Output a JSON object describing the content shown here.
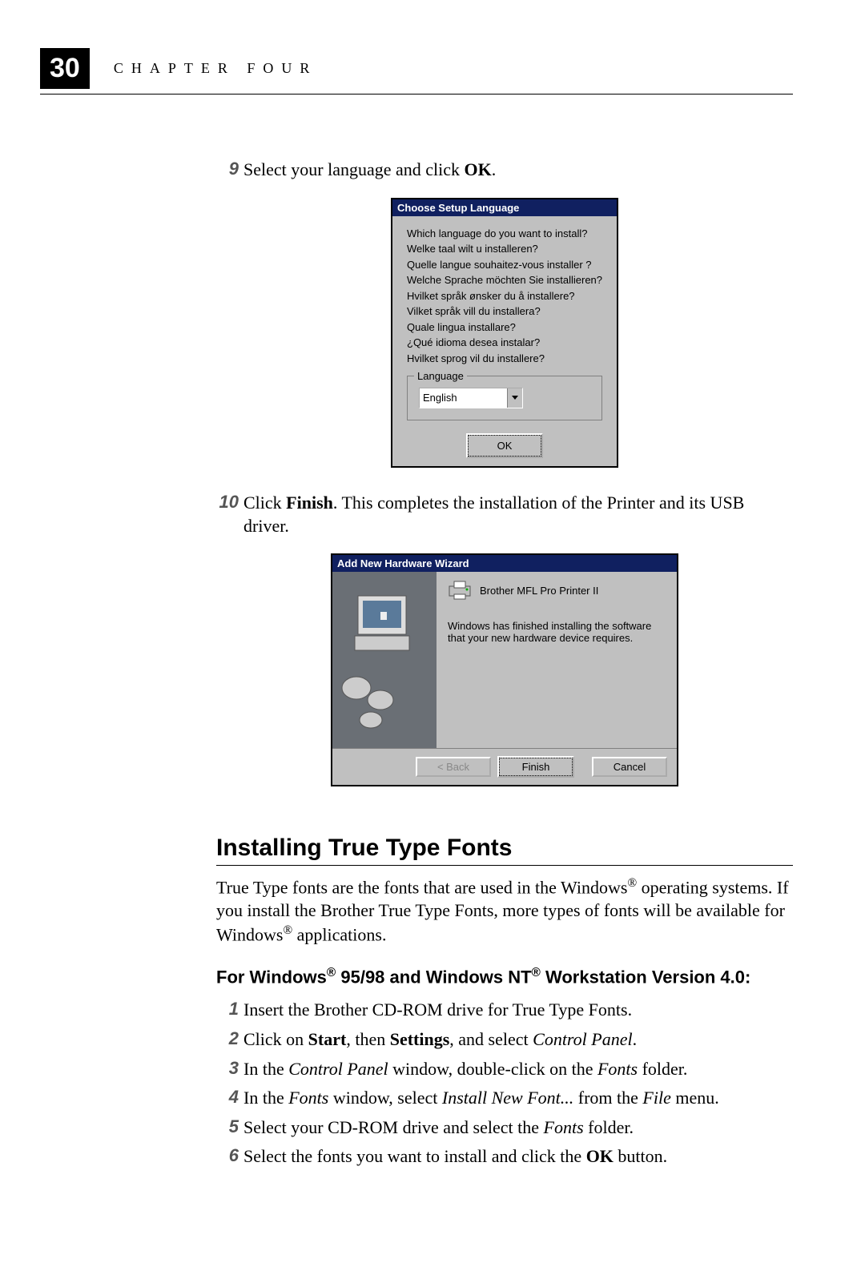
{
  "header": {
    "page_number": "30",
    "chapter_label": "CHAPTER FOUR"
  },
  "step9": {
    "num": "9",
    "pre": "Select your language and click ",
    "bold": "OK",
    "post": "."
  },
  "lang_dialog": {
    "title": "Choose Setup Language",
    "lines": [
      "Which language do you want to install?",
      "Welke taal wilt u installeren?",
      "Quelle langue souhaitez-vous installer ?",
      "Welche Sprache möchten Sie installieren?",
      "Hvilket språk ønsker du å installere?",
      "Vilket språk vill du installera?",
      "Quale lingua installare?",
      "¿Qué idioma desea instalar?",
      "Hvilket sprog vil du installere?"
    ],
    "group_label": "Language",
    "selected": "English",
    "ok": "OK"
  },
  "step10": {
    "num": "10",
    "t1": "Click ",
    "b1": "Finish",
    "t2": ". This completes the installation of the Printer and its USB driver."
  },
  "wizard": {
    "title": "Add New Hardware Wizard",
    "product": "Brother MFL Pro Printer II",
    "message": "Windows has finished installing the software that your new hardware device requires.",
    "back": "< Back",
    "finish": "Finish",
    "cancel": "Cancel"
  },
  "section": {
    "title": "Installing True Type Fonts",
    "para_1": "True Type fonts are the fonts that are used in the Windows",
    "para_2": " operating systems. If you install the Brother True Type Fonts, more types of fonts will be available for Windows",
    "para_3": " applications."
  },
  "subheading": {
    "t1": "For Windows",
    "t2": " 95/98 and Windows NT",
    "t3": " Workstation Version 4.0:"
  },
  "steps": {
    "s1": {
      "num": "1",
      "text": "Insert the Brother CD-ROM drive for True Type Fonts."
    },
    "s2": {
      "num": "2",
      "t1": "Click on ",
      "b1": "Start",
      "t2": ", then ",
      "b2": "Settings",
      "t3": ", and select ",
      "i1": "Control Panel",
      "t4": "."
    },
    "s3": {
      "num": "3",
      "t1": "In the ",
      "i1": "Control Panel",
      "t2": " window, double-click on the ",
      "i2": "Fonts",
      "t3": " folder."
    },
    "s4": {
      "num": "4",
      "t1": "In the ",
      "i1": "Fonts",
      "t2": " window, select ",
      "i2": "Install New Font...",
      "t3": " from the ",
      "i3": "File",
      "t4": " menu."
    },
    "s5": {
      "num": "5",
      "t1": "Select your CD-ROM drive and select the ",
      "i1": "Fonts",
      "t2": " folder."
    },
    "s6": {
      "num": "6",
      "t1": "Select the fonts you want to install and click the ",
      "b1": "OK",
      "t2": " button."
    }
  }
}
